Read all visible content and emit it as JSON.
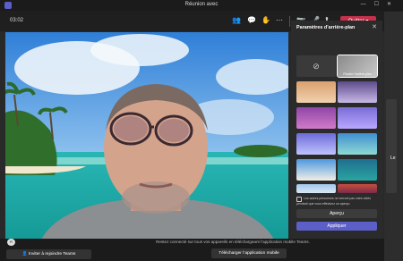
{
  "window": {
    "title": "Réunion avec",
    "controls": [
      "minimize-icon",
      "maximize-icon",
      "close-icon"
    ]
  },
  "meeting": {
    "timer": "03:02",
    "quit_label": "Quitter",
    "toolbar_icons": [
      "participants-icon",
      "chat-icon",
      "reactions-icon",
      "more-icon",
      "camera-icon",
      "mic-icon",
      "share-icon"
    ]
  },
  "background_panel": {
    "title": "Paramètres d’arrière-plan",
    "blur_label": "Flouter l’arrière-plan",
    "none_icon": "no-background-icon",
    "option_text": "Les autres personnes ne verront pas votre vidéo pendant que vous effectuez un aperçu",
    "preview_label": "Aperçu",
    "apply_label": "Appliquer"
  },
  "side": {
    "visible_letter": "Le"
  },
  "bottom": {
    "avatar_initials": "PI",
    "invite_label": "Inviter à rejoindre Teams",
    "mobile_text": "Restez connecté sur tous vos appareils en téléchargeant l’application mobile Teams.",
    "download_label": "Télécharger l’application mobile"
  },
  "colors": {
    "accent": "#5b5fc7",
    "quit": "#c4314b",
    "panel": "#2b2b2b"
  }
}
